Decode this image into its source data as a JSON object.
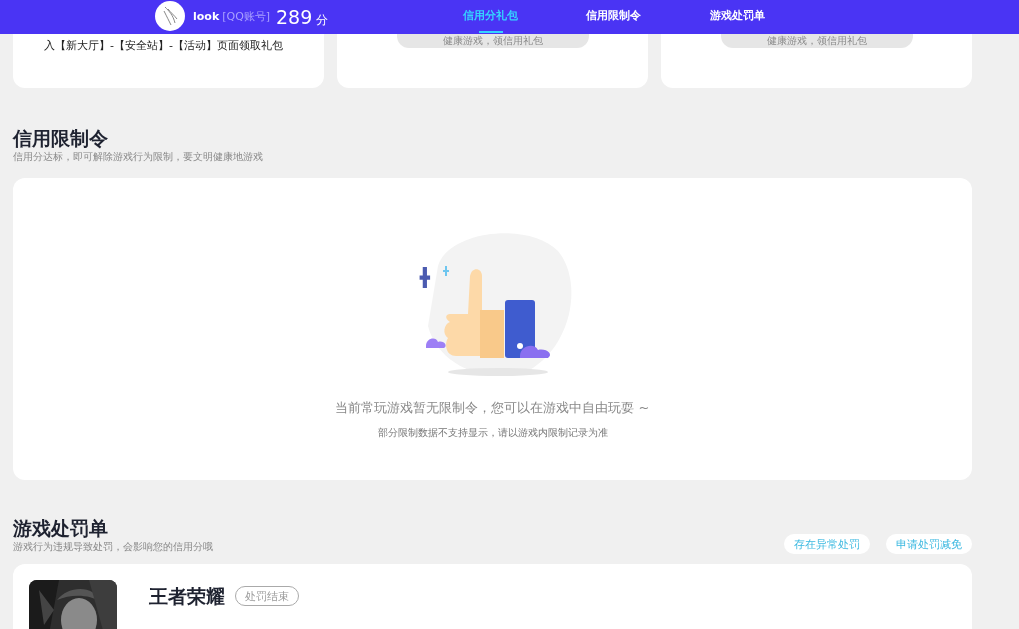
{
  "header": {
    "user": {
      "name": "look",
      "account_type": "[QQ账号]",
      "score": "289",
      "score_unit": "分"
    },
    "tabs": [
      {
        "label": "信用分礼包",
        "selected": true
      },
      {
        "label": "信用限制令",
        "selected": false
      },
      {
        "label": "游戏处罚单",
        "selected": false
      }
    ]
  },
  "gift_cards": [
    {
      "kind": "text",
      "text": "入【新大厅】-【安全站】-【活动】页面领取礼包"
    },
    {
      "kind": "button",
      "label": "健康游戏，领信用礼包",
      "disabled": true
    },
    {
      "kind": "button",
      "label": "健康游戏，领信用礼包",
      "disabled": true
    }
  ],
  "restrictions": {
    "title": "信用限制令",
    "subtitle": "信用分达标，即可解除游戏行为限制，要文明健康地游戏",
    "empty": {
      "message": "当前常玩游戏暂无限制令，您可以在游戏中自由玩耍 ~",
      "note": "部分限制数据不支持显示，请以游戏内限制记录为准"
    }
  },
  "penalties": {
    "title": "游戏处罚单",
    "subtitle": "游戏行为违规导致处罚，会影响您的信用分哦",
    "buttons": [
      "存在异常处罚",
      "申请处罚减免"
    ],
    "records": [
      {
        "game": "王者荣耀",
        "status": "处罚结束"
      }
    ]
  }
}
